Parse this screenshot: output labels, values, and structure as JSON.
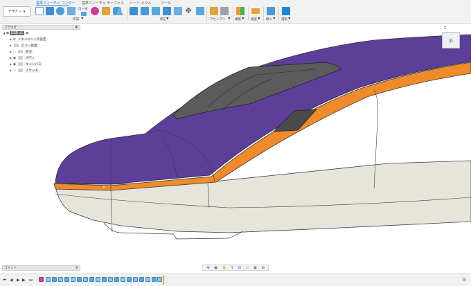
{
  "toolbar": {
    "workspace": "デザイン",
    "tabs": [
      {
        "label": "基準フィーチャ コンター",
        "active": true
      },
      {
        "label": "基準フィーチャ サーフェス",
        "active": false
      },
      {
        "label": "シート メタル",
        "active": false
      },
      {
        "label": "ツール",
        "active": false
      }
    ],
    "tab_fragment": "ロー本",
    "groups": [
      "作成",
      "修正",
      "アセンブリ",
      "構築",
      "検査",
      "挿入",
      "選択"
    ]
  },
  "browser": {
    "title": "ブラウザ",
    "root": "E5系 v1",
    "items": [
      "ドキュメントの設定",
      "ビュー管理",
      "原点",
      "ボディ",
      "キャンバス",
      "スケッチ"
    ]
  },
  "viewcube": {
    "face": "前",
    "axis": "Z"
  },
  "comments": {
    "title": "コメント"
  },
  "colors": {
    "purple": "#5d3f99",
    "orange": "#ef8a2d",
    "body": "#e7e4db",
    "accent": "#1a73c8"
  }
}
